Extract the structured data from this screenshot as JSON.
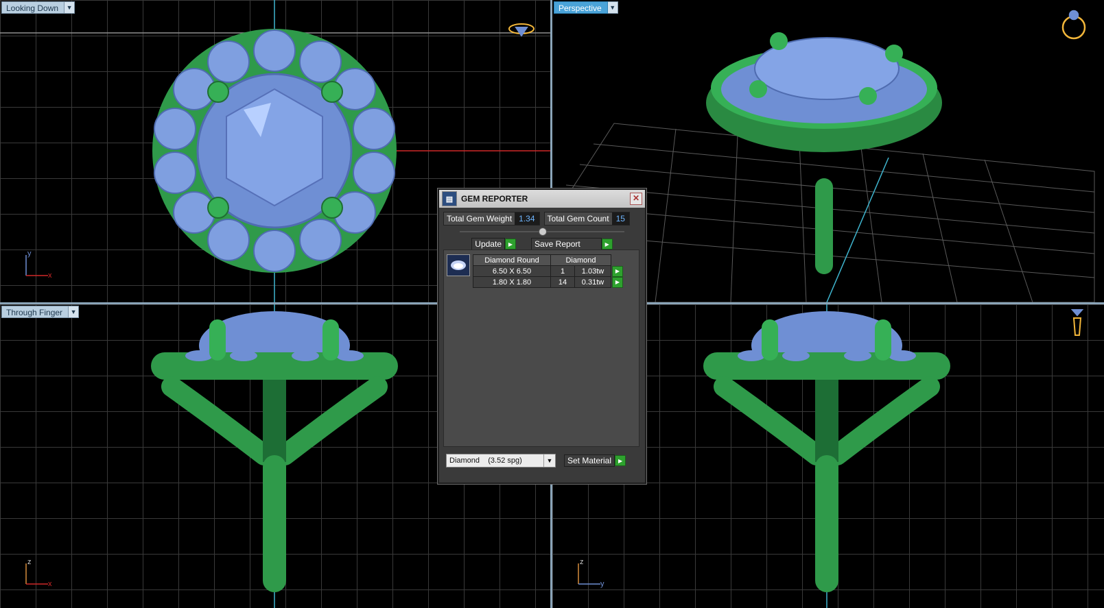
{
  "viewports": {
    "top_left": {
      "label": "Looking Down",
      "axes": [
        "y",
        "x"
      ]
    },
    "top_right": {
      "label": "Perspective"
    },
    "bottom_left": {
      "label": "Through Finger",
      "axes": [
        "z",
        "x"
      ]
    },
    "bottom_right": {
      "axes": [
        "z",
        "y"
      ]
    }
  },
  "dialog": {
    "title": "GEM REPORTER",
    "total_weight_label": "Total Gem Weight",
    "total_weight_value": "1.34",
    "total_count_label": "Total Gem Count",
    "total_count_value": "15",
    "update_label": "Update",
    "save_label": "Save Report",
    "table": {
      "headers": [
        "Diamond Round",
        "Diamond"
      ],
      "rows": [
        {
          "size": "6.50 X 6.50",
          "count": "1",
          "weight": "1.03tw"
        },
        {
          "size": "1.80 X 1.80",
          "count": "14",
          "weight": "0.31tw"
        }
      ]
    },
    "material_select": "Diamond    (3.52 spg)",
    "set_material_label": "Set Material"
  },
  "colors": {
    "metal": "#2f9a4a",
    "gem": "#7f9fe0",
    "accent": "#4aa3d8"
  }
}
